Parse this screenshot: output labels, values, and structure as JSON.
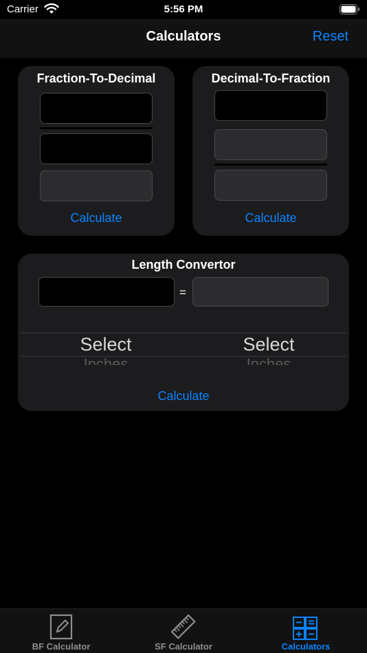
{
  "status_bar": {
    "carrier": "Carrier",
    "time": "5:56 PM"
  },
  "nav": {
    "title": "Calculators",
    "reset_label": "Reset"
  },
  "fraction_to_decimal": {
    "title": "Fraction-To-Decimal",
    "calculate_label": "Calculate"
  },
  "decimal_to_fraction": {
    "title": "Decimal-To-Fraction",
    "calculate_label": "Calculate"
  },
  "length_convertor": {
    "title": "Length Convertor",
    "equals": "=",
    "picker_from": {
      "selected": "Select",
      "next": "Inches"
    },
    "picker_to": {
      "selected": "Select",
      "next": "Inches"
    },
    "calculate_label": "Calculate"
  },
  "tabs": [
    {
      "label": "BF Calculator",
      "icon": "pencil-square-icon",
      "active": false
    },
    {
      "label": "SF Calculator",
      "icon": "ruler-icon",
      "active": false
    },
    {
      "label": "Calculators",
      "icon": "calculator-icon",
      "active": true
    }
  ],
  "colors": {
    "accent": "#0a84ff",
    "card": "#1c1c1e",
    "field_gray": "#2c2c2e",
    "background": "#000000"
  }
}
